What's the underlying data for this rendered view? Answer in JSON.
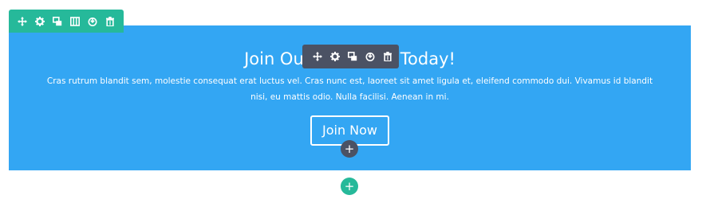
{
  "colors": {
    "section_bg": "#33a6f3",
    "row_toolbar": "#26b99a",
    "module_toolbar": "#4b5264",
    "text": "#ffffff"
  },
  "row_toolbar": {
    "icons": [
      "move-icon",
      "settings-icon",
      "duplicate-icon",
      "columns-icon",
      "save-icon",
      "delete-icon"
    ]
  },
  "module_toolbar": {
    "icons": [
      "move-icon",
      "settings-icon",
      "duplicate-icon",
      "save-icon",
      "delete-icon"
    ]
  },
  "cta": {
    "title_left": "Join Ou",
    "title_right": "Today!",
    "body": "Cras rutrum blandit sem, molestie consequat erat luctus vel. Cras nunc est, laoreet sit amet ligula et, eleifend commodo dui. Vivamus id blandit nisi, eu mattis odio. Nulla facilisi. Aenean in mi.",
    "button_label": "Join Now"
  },
  "add_module_symbol": "+",
  "add_section_symbol": "+"
}
